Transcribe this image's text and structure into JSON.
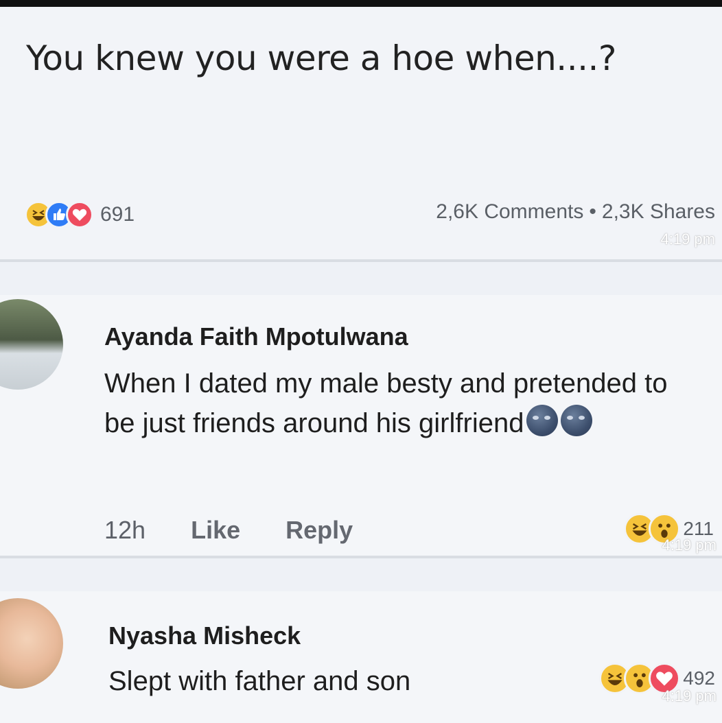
{
  "post": {
    "text": "You knew you were a hoe when....?",
    "reactions": [
      "haha-icon",
      "like-icon",
      "love-icon"
    ],
    "reaction_count": "691",
    "comments": "2,6K Comments",
    "separator": "•",
    "shares": "2,3K Shares",
    "timestamp": "4:19 pm"
  },
  "comments": [
    {
      "author": "Ayanda Faith Mpotulwana",
      "text": "When I dated my male besty and pretended to be just friends around his girlfriend",
      "emojis": [
        "new-moon-face-icon",
        "new-moon-face-icon"
      ],
      "time": "12h",
      "like_label": "Like",
      "reply_label": "Reply",
      "reactions": [
        "haha-icon",
        "wow-icon"
      ],
      "reaction_count": "211",
      "timestamp": "4:19 pm"
    },
    {
      "author": "Nyasha Misheck",
      "text": "Slept with father and son",
      "reactions": [
        "haha-icon",
        "wow-icon",
        "love-icon"
      ],
      "reaction_count": "492",
      "timestamp": "4:19 pm"
    }
  ],
  "colors": {
    "like": "#2f7cf6",
    "love": "#ee4c5f",
    "haha": "#f5c33b"
  }
}
